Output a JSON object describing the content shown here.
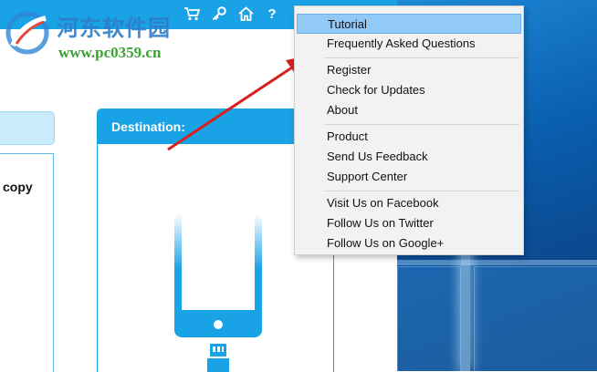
{
  "watermark": {
    "chinese": "河东软件园",
    "url": "www.pc0359.cn"
  },
  "toolbar": {
    "icons": [
      "cart-icon",
      "key-icon",
      "home-icon",
      "help-icon"
    ],
    "help_glyph": "?"
  },
  "source": {
    "panel_text": "copy"
  },
  "destination": {
    "title": "Destination:"
  },
  "menu": {
    "groups": [
      [
        "Tutorial",
        "Frequently Asked Questions"
      ],
      [
        "Register",
        "Check for Updates",
        "About"
      ],
      [
        "Product",
        "Send Us Feedback",
        "Support Center"
      ],
      [
        "Visit Us on Facebook",
        "Follow Us on Twitter",
        "Follow Us on Google+"
      ]
    ],
    "active_item": "Tutorial"
  },
  "colors": {
    "accent": "#1aa2e6",
    "menu_highlight": "#91c9f7",
    "annotation_arrow": "#d81e1e"
  }
}
